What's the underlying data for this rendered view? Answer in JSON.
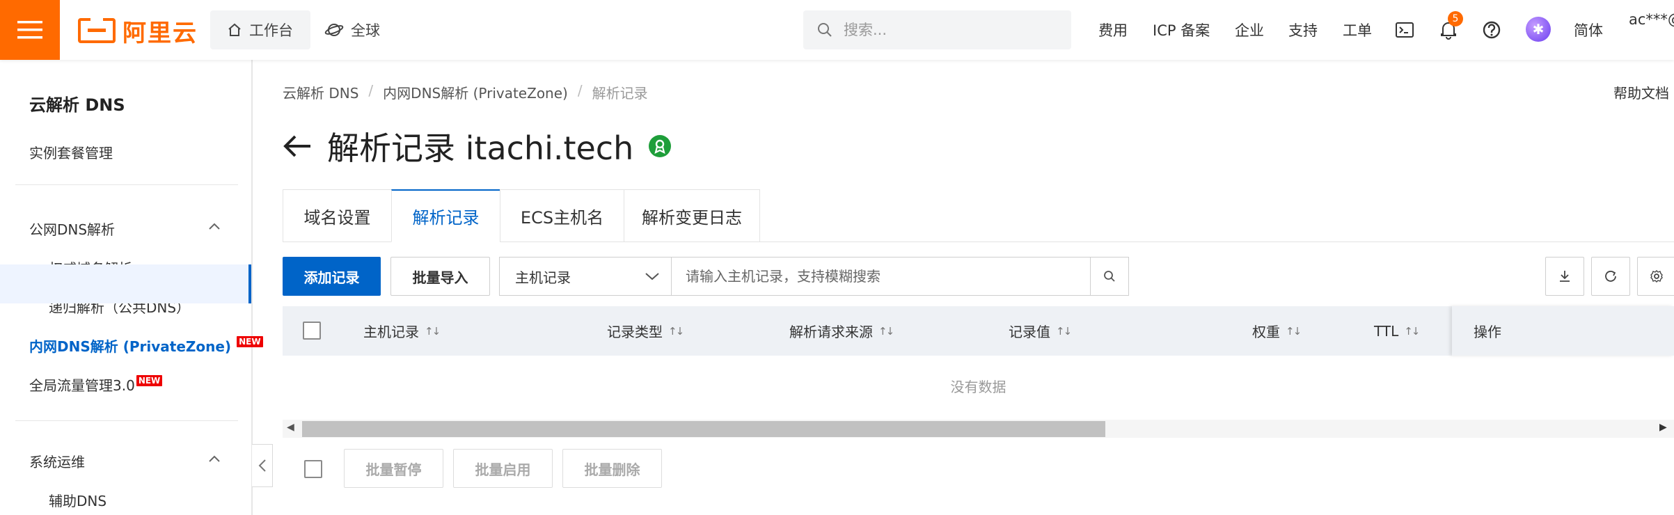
{
  "colors": {
    "brand": "#ff6a00",
    "primary": "#0064c8",
    "success": "#1e9e3a",
    "badge_new": "#e00000"
  },
  "header": {
    "logo_text": "阿里云",
    "workbench_label": "工作台",
    "global_label": "全球",
    "search_placeholder": "搜索...",
    "links": [
      "费用",
      "ICP 备案",
      "企业",
      "支持",
      "工单"
    ],
    "notification_count": "5",
    "language": "简体",
    "account": "ac***@"
  },
  "sidebar": {
    "title": "云解析 DNS",
    "items": {
      "instance": "实例套餐管理",
      "public_dns": "公网DNS解析",
      "authoritative": "权威域名解析",
      "recursive": "递归解析（公共DNS）",
      "private_zone": "内网DNS解析 (PrivateZone)",
      "gtm": "全局流量管理3.0",
      "ops": "系统运维",
      "aux_dns": "辅助DNS"
    },
    "new_badge": "NEW"
  },
  "breadcrumb": [
    "云解析 DNS",
    "/",
    "内网DNS解析 (PrivateZone)",
    "/",
    "解析记录"
  ],
  "help_doc": "帮助文档",
  "page_title": "解析记录 itachi.tech",
  "tabs": [
    "域名设置",
    "解析记录",
    "ECS主机名",
    "解析变更日志"
  ],
  "toolbar": {
    "add_label": "添加记录",
    "import_label": "批量导入",
    "field_select_value": "主机记录",
    "filter_placeholder": "请输入主机记录，支持模糊搜索"
  },
  "table": {
    "columns": [
      "主机记录",
      "记录类型",
      "解析请求来源",
      "记录值",
      "权重",
      "TTL",
      "操作"
    ],
    "sort_glyph": "↑↓",
    "empty_text": "没有数据"
  },
  "batch": {
    "pause": "批量暂停",
    "enable": "批量启用",
    "delete": "批量删除"
  }
}
